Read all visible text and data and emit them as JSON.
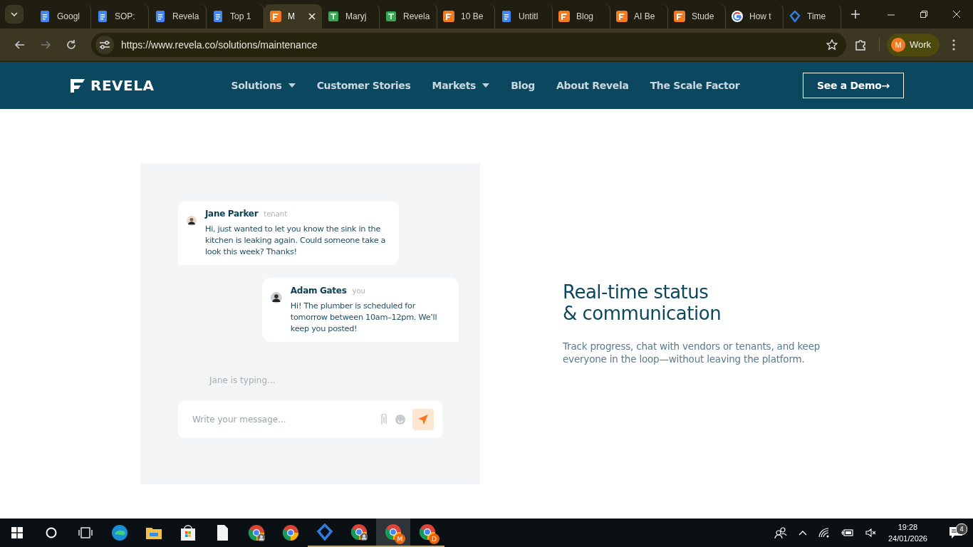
{
  "browser": {
    "tabs": [
      {
        "title": "Googl",
        "kind": "doc",
        "selected": false
      },
      {
        "title": "SOP:",
        "kind": "doc",
        "selected": false
      },
      {
        "title": "Revela",
        "kind": "doc",
        "selected": false
      },
      {
        "title": "Top 1",
        "kind": "doc",
        "selected": false
      },
      {
        "title": "M",
        "kind": "revela",
        "selected": true
      },
      {
        "title": "Maryj",
        "kind": "sheet",
        "selected": false
      },
      {
        "title": "Revela",
        "kind": "sheet",
        "selected": false
      },
      {
        "title": "10 Be",
        "kind": "revela",
        "selected": false
      },
      {
        "title": "Untitl",
        "kind": "doc",
        "selected": false
      },
      {
        "title": "Blog",
        "kind": "revela",
        "selected": false
      },
      {
        "title": "AI Be",
        "kind": "revela",
        "selected": false
      },
      {
        "title": "Stude",
        "kind": "revela",
        "selected": false
      },
      {
        "title": "How t",
        "kind": "google",
        "selected": false
      },
      {
        "title": "Time",
        "kind": "drive",
        "selected": false
      }
    ],
    "url": "https://www.revela.co/solutions/maintenance",
    "profile": {
      "initial": "M",
      "label": "Work"
    }
  },
  "site": {
    "logo": "REVELA",
    "nav": [
      {
        "label": "Solutions",
        "dropdown": true
      },
      {
        "label": "Customer Stories",
        "dropdown": false
      },
      {
        "label": "Markets",
        "dropdown": true
      },
      {
        "label": "Blog",
        "dropdown": false
      },
      {
        "label": "About Revela",
        "dropdown": false
      },
      {
        "label": "The Scale Factor",
        "dropdown": false
      }
    ],
    "cta": {
      "label": "See a Demo",
      "arrow": "→"
    }
  },
  "chat": {
    "messages": [
      {
        "name": "Jane Parker",
        "role": "tenant",
        "text": "Hi, just wanted to let you know the sink in the kitchen is leaking again. Could someone take a look this week? Thanks!",
        "kind": "incoming"
      },
      {
        "name": "Adam Gates",
        "role": "you",
        "text": "Hi! The plumber is scheduled for tomorrow between 10am–12pm. We’ll keep you posted!",
        "kind": "outgoing"
      }
    ],
    "typing": "Jane is typing...",
    "input": {
      "placeholder": "Write your message..."
    }
  },
  "feature": {
    "title_lines": [
      "Real-time status",
      "& communication"
    ],
    "description": "Track progress, chat with vendors or tenants, and keep everyone in the loop—without leaving the platform."
  },
  "taskbar": {
    "apps": [
      {
        "kind": "edge",
        "running": false,
        "active": false
      },
      {
        "kind": "folder",
        "running": false,
        "active": false
      },
      {
        "kind": "store",
        "running": false,
        "active": false
      },
      {
        "kind": "file",
        "running": false,
        "active": false
      },
      {
        "kind": "chrome-person",
        "running": false,
        "active": false
      },
      {
        "kind": "chrome",
        "running": false,
        "active": false
      },
      {
        "kind": "drive",
        "running": true,
        "active": false
      },
      {
        "kind": "chrome-person",
        "running": true,
        "active": false
      },
      {
        "kind": "chrome",
        "badge": "M",
        "running": true,
        "active": true
      },
      {
        "kind": "chrome",
        "badge": "D",
        "running": true,
        "active": false
      }
    ],
    "time": "19:28",
    "date": "24/01/2026",
    "notifications": "4"
  }
}
